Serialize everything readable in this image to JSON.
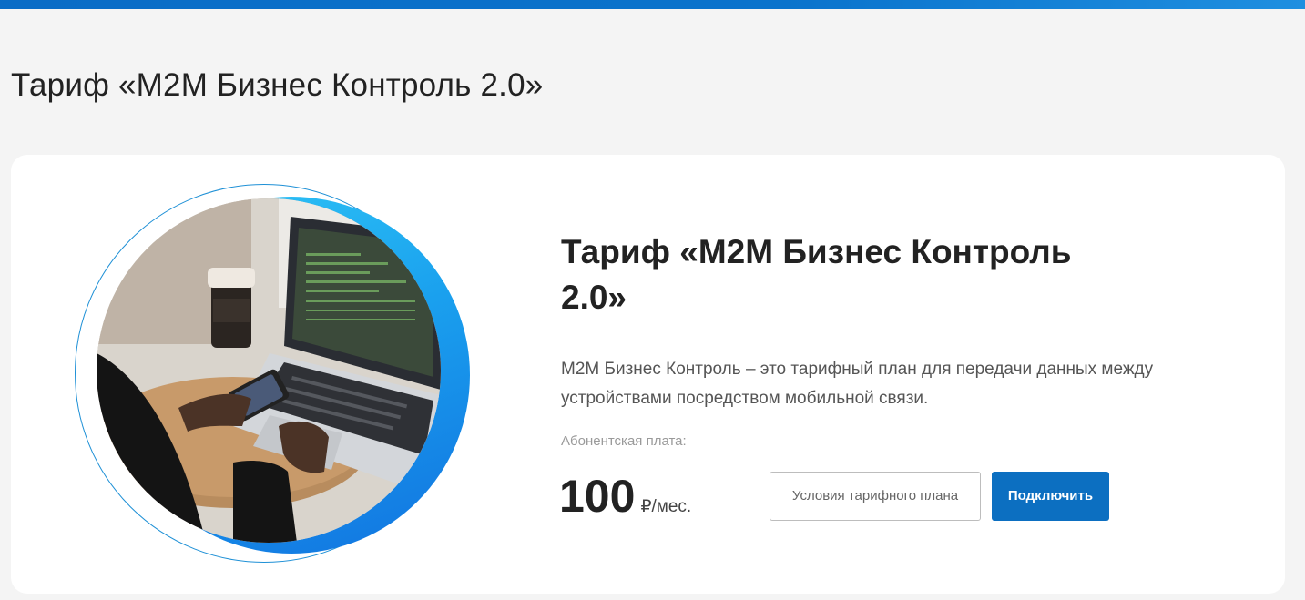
{
  "page": {
    "title": "Тариф «M2M Бизнес Контроль 2.0»"
  },
  "card": {
    "title": "Тариф «M2M Бизнес Контроль 2.0»",
    "description": "M2M Бизнес Контроль – это тарифный план для передачи данных между устройствами посредством мобильной связи.",
    "fee_label": "Абонентская плата:",
    "price_value": "100",
    "price_unit": "₽/мес.",
    "conditions_button": "Условия тарифного плана",
    "connect_button": "Подключить"
  },
  "colors": {
    "accent": "#0c6fc1",
    "top_bar": "#0a6cc6",
    "ring": "#1e90d6"
  },
  "illustration": {
    "icon": "laptop-photo"
  }
}
